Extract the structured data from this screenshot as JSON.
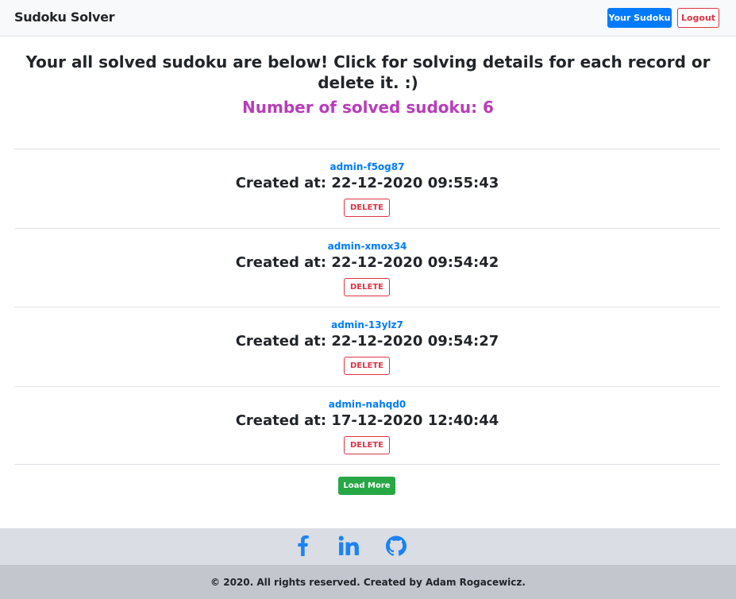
{
  "navbar": {
    "brand": "Sudoku Solver",
    "your_sudoku_label": "Your Sudoku",
    "logout_label": "Logout"
  },
  "main": {
    "heading": "Your all solved sudoku are below! Click for solving details for each record or delete it. :)",
    "count_text": "Number of solved sudoku: 6",
    "records": [
      {
        "id": "admin-f5og87",
        "created": "Created at: 22-12-2020 09:55:43",
        "delete_label": "DELETE"
      },
      {
        "id": "admin-xmox34",
        "created": "Created at: 22-12-2020 09:54:42",
        "delete_label": "DELETE"
      },
      {
        "id": "admin-13ylz7",
        "created": "Created at: 22-12-2020 09:54:27",
        "delete_label": "DELETE"
      },
      {
        "id": "admin-nahqd0",
        "created": "Created at: 17-12-2020 12:40:44",
        "delete_label": "DELETE"
      }
    ],
    "load_more_label": "Load More"
  },
  "footer": {
    "icons": [
      "facebook-icon",
      "linkedin-icon",
      "github-icon"
    ],
    "copyright": "© 2020. All rights reserved. Created by Adam Rogacewicz."
  },
  "colors": {
    "primary": "#007bff",
    "danger": "#dc3545",
    "success": "#28a745",
    "count_purple": "#b83cb9",
    "icon_blue": "#1a82f7"
  }
}
